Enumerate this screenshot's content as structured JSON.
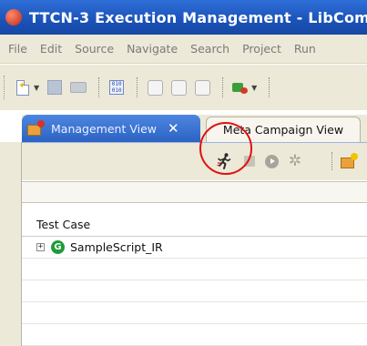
{
  "window": {
    "title": "TTCN-3 Execution Management - LibComm"
  },
  "menu": {
    "items": [
      "File",
      "Edit",
      "Source",
      "Navigate",
      "Search",
      "Project",
      "Run"
    ]
  },
  "icons": {
    "app": "app-logo-icon",
    "new": "new-document-icon",
    "save": "save-icon",
    "print": "print-icon",
    "binary": "binary-file-icon",
    "run_external": "run-external-icon",
    "view_tab": "management-view-icon",
    "run_test": "run-test-icon",
    "stop": "stop-icon",
    "resume": "resume-icon",
    "debug": "debug-icon",
    "test_case": "test-case-icon"
  },
  "tabs": [
    {
      "label": "Management View",
      "active": true,
      "close": "✕"
    },
    {
      "label": "Meta Campaign View",
      "active": false
    }
  ],
  "table": {
    "columns": [
      "Test Case"
    ],
    "rows": [
      {
        "expander": "+",
        "icon_letter": "G",
        "label": "SampleScript_IR"
      }
    ]
  },
  "colors": {
    "title_bar": "#1a52b8",
    "active_tab": "#2c63c4",
    "highlight_circle": "#e01010",
    "test_case_icon": "#1f9b3a"
  }
}
